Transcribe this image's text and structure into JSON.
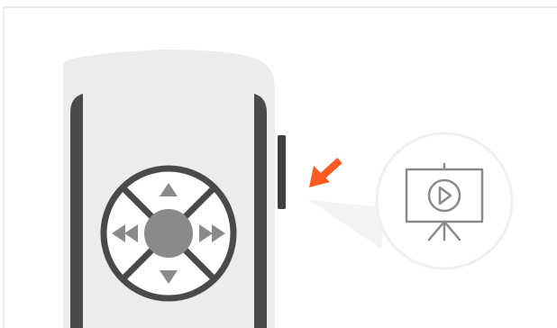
{
  "illustration": {
    "subject": "presenter-remote-side-view",
    "colors": {
      "background": "#ffffff",
      "border": "#ececec",
      "body": "#ececec",
      "grip": "#4a4a4d",
      "dpad_ring": "#4a4a4d",
      "dpad_fill": "#ffffff",
      "center_button": "#8a8a88",
      "arrow": "#8a8a88",
      "side_button": "#3f3f42",
      "pointer_arrow": "#fe5b22",
      "callout_bubble": "#ffffff",
      "callout_border": "#f0f0f0",
      "callout_beam": "#f3f3f3",
      "presentation_icon": "#8a8a88"
    },
    "icons": {
      "up": "triangle-up-icon",
      "down": "triangle-down-icon",
      "left": "rewind-icon",
      "right": "fast-forward-icon",
      "pointer": "arrow-pointer-icon",
      "callout": "presentation-play-icon"
    }
  }
}
